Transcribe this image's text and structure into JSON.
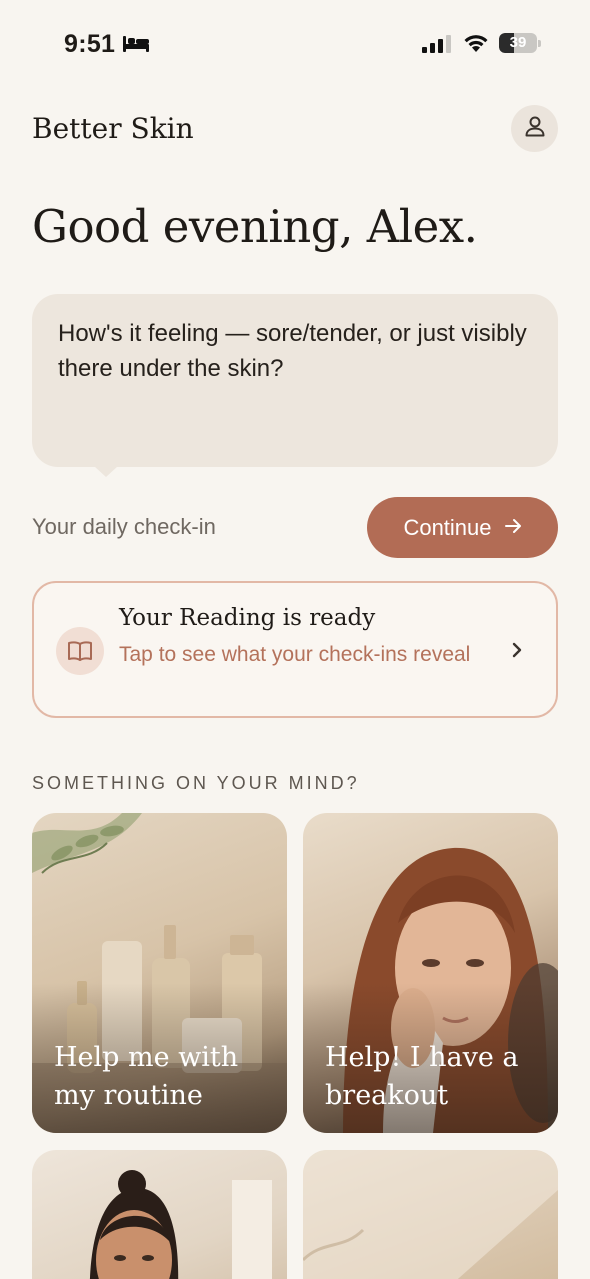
{
  "status_bar": {
    "time": "9:51",
    "battery": "39",
    "battery_level": 0.39
  },
  "header": {
    "app_title": "Better Skin",
    "profile_icon": "person-icon"
  },
  "greeting": "Good evening, Alex.",
  "check_in": {
    "question": "How's it feeling — sore/tender, or just visibly there under the skin?",
    "label": "Your daily check-in",
    "continue_label": "Continue",
    "continue_icon": "arrow-right-icon"
  },
  "reading_card": {
    "title": "Your Reading is ready",
    "subtitle": "Tap to see what your check-ins reveal",
    "icon": "book-icon"
  },
  "topics": {
    "heading": "SOMETHING ON YOUR MIND?",
    "items": [
      {
        "label": "Help me with my routine",
        "image": "skincare-bottles-photo"
      },
      {
        "label": "Help! I have a breakout",
        "image": "woman-touching-cheek-photo"
      },
      {
        "label": "",
        "image": "woman-portrait-photo"
      },
      {
        "label": "",
        "image": "sunlit-wall-photo"
      }
    ]
  },
  "colors": {
    "background": "#f8f5f0",
    "accent": "#b26c55",
    "bubble": "#ede6dd",
    "card_border": "#e2b8a6"
  }
}
